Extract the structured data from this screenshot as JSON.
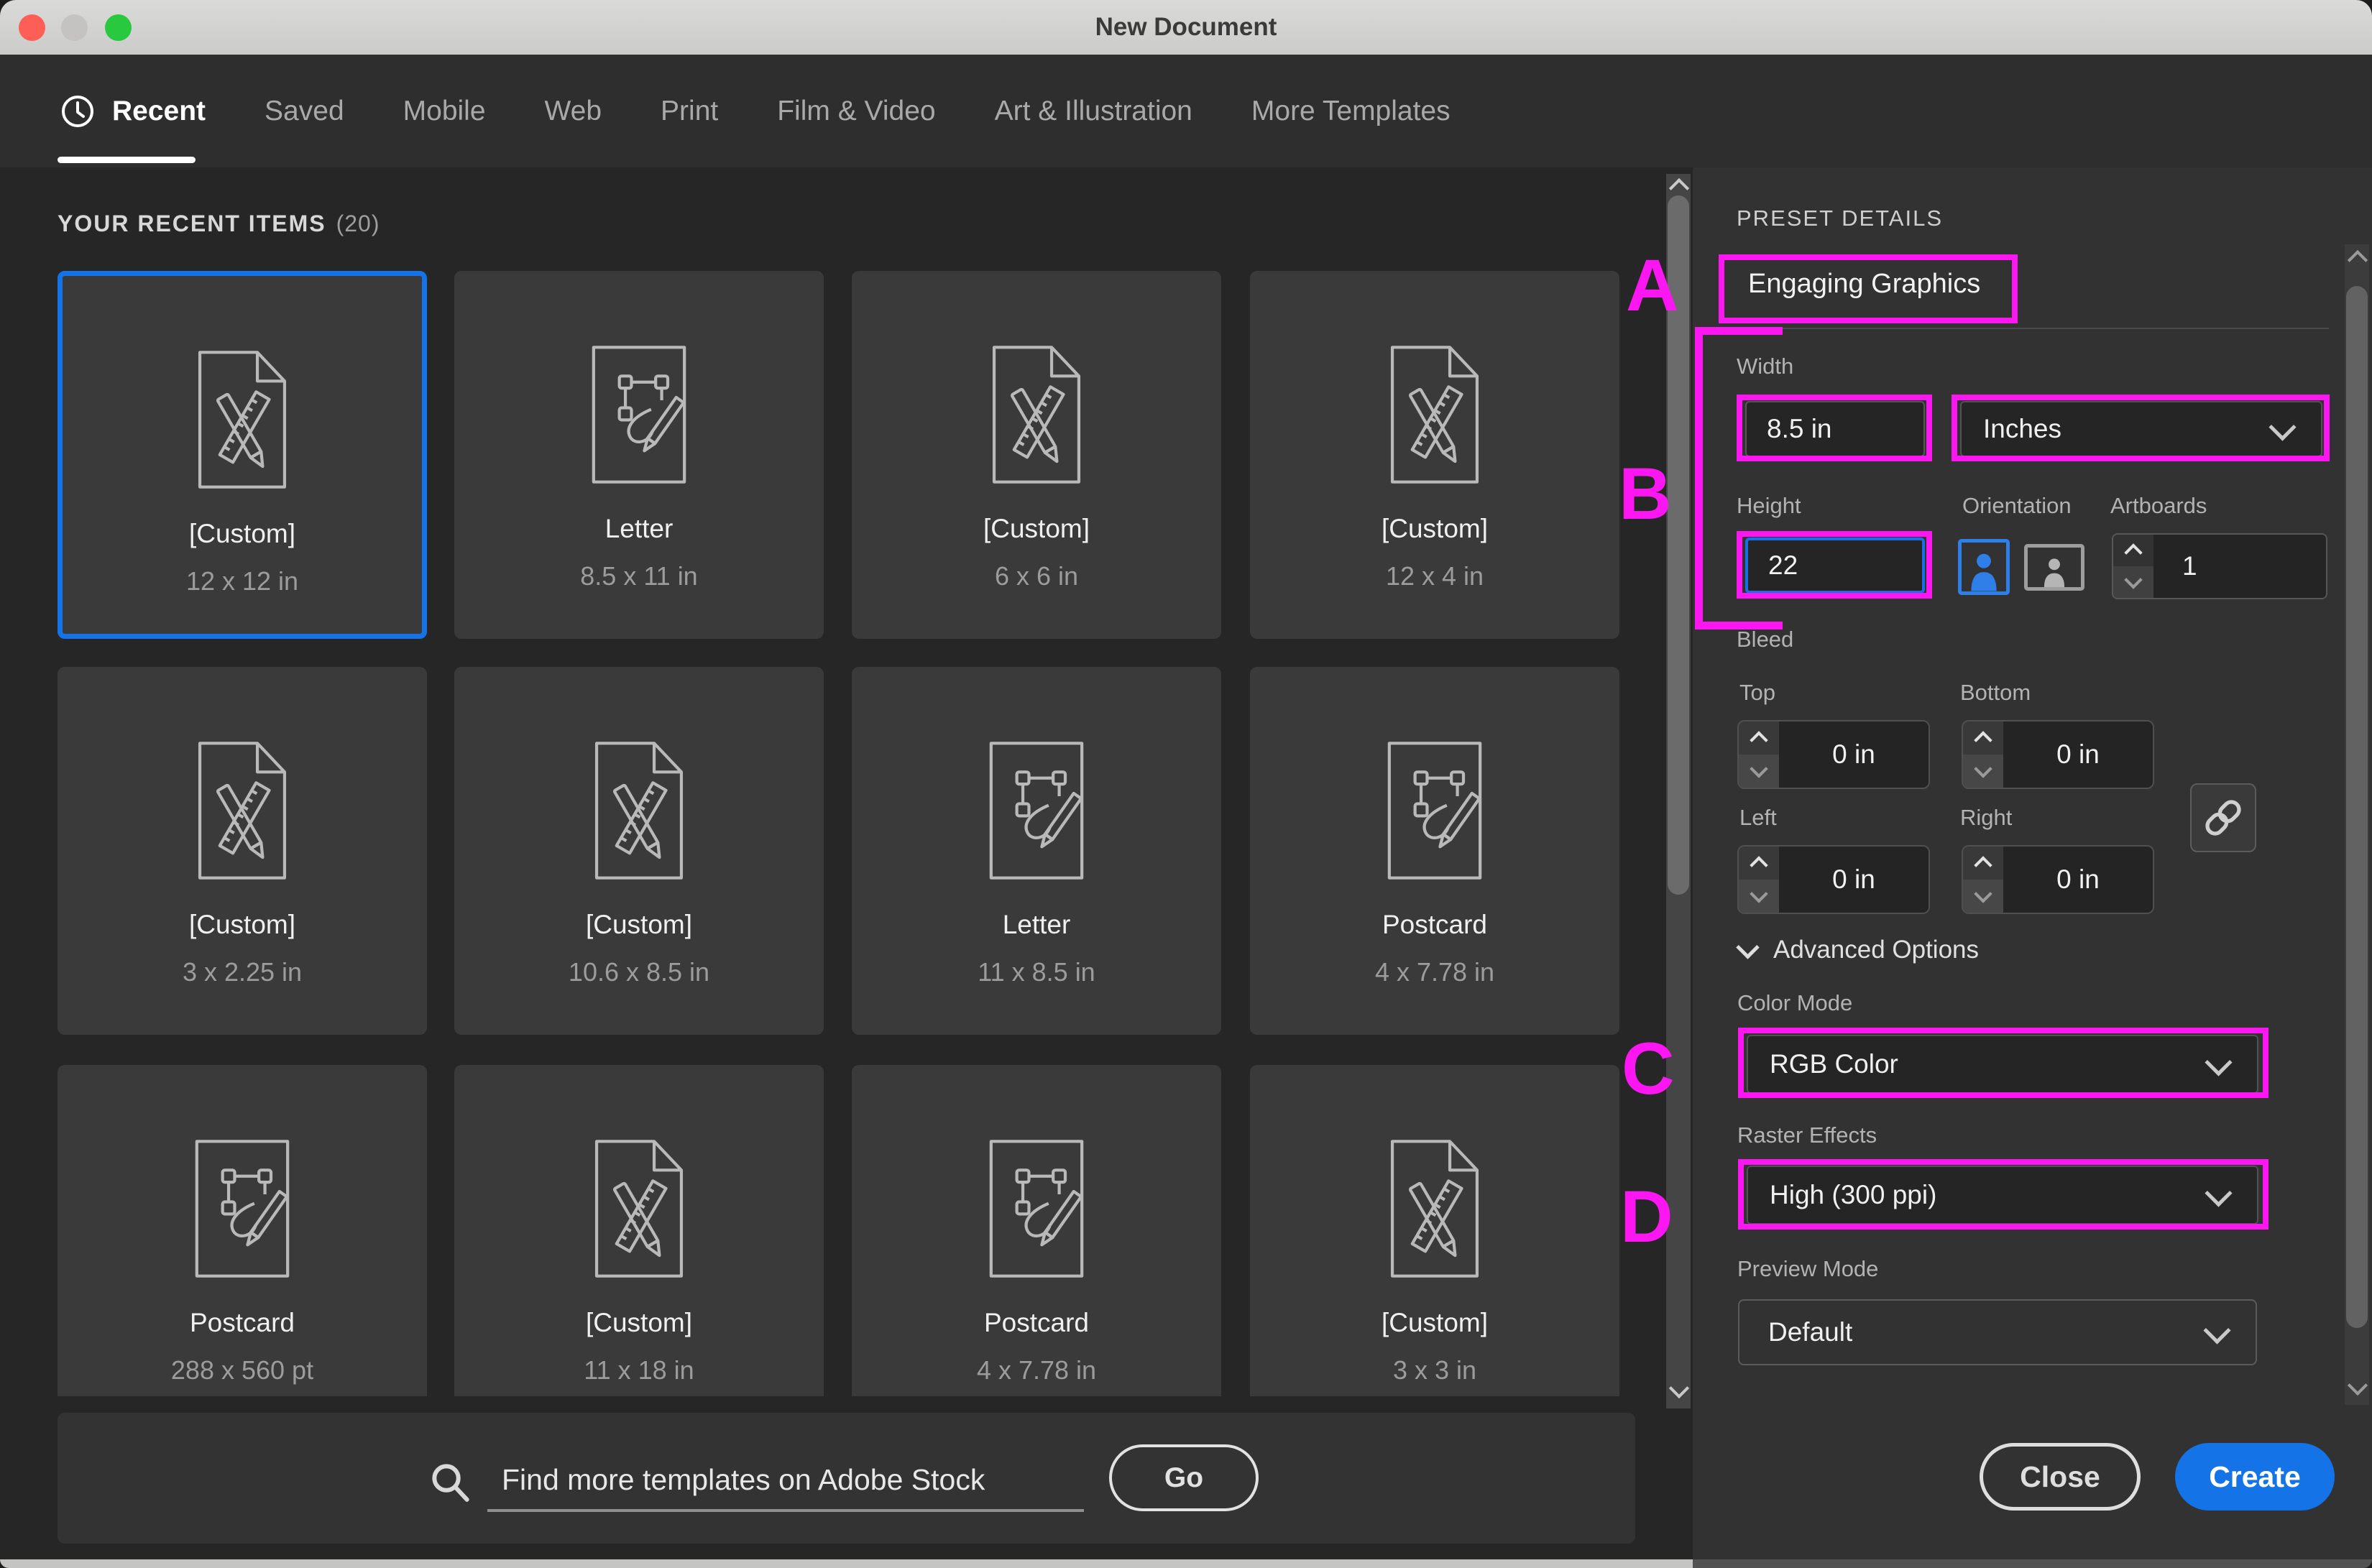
{
  "window": {
    "title": "New Document",
    "traffic_lights": [
      "close",
      "minimize",
      "zoom"
    ]
  },
  "tabs": {
    "items": [
      {
        "label": "Recent",
        "active": true,
        "icon": "clock-icon"
      },
      {
        "label": "Saved",
        "active": false
      },
      {
        "label": "Mobile",
        "active": false
      },
      {
        "label": "Web",
        "active": false
      },
      {
        "label": "Print",
        "active": false
      },
      {
        "label": "Film & Video",
        "active": false
      },
      {
        "label": "Art & Illustration",
        "active": false
      },
      {
        "label": "More Templates",
        "active": false
      }
    ]
  },
  "recent": {
    "heading": "YOUR RECENT ITEMS",
    "count": "(20)",
    "items": [
      {
        "name": "[Custom]",
        "size": "12 x 12 in",
        "icon": "custom-doc-icon",
        "selected": true
      },
      {
        "name": "Letter",
        "size": "8.5 x 11 in",
        "icon": "vector-pen-icon",
        "selected": false
      },
      {
        "name": "[Custom]",
        "size": "6 x 6 in",
        "icon": "custom-doc-icon",
        "selected": false
      },
      {
        "name": "[Custom]",
        "size": "12 x 4 in",
        "icon": "custom-doc-icon",
        "selected": false
      },
      {
        "name": "[Custom]",
        "size": "3 x 2.25 in",
        "icon": "custom-doc-icon",
        "selected": false
      },
      {
        "name": "[Custom]",
        "size": "10.6 x 8.5 in",
        "icon": "custom-doc-icon",
        "selected": false
      },
      {
        "name": "Letter",
        "size": "11 x 8.5 in",
        "icon": "vector-pen-icon",
        "selected": false
      },
      {
        "name": "Postcard",
        "size": "4 x 7.78 in",
        "icon": "vector-pen-icon",
        "selected": false
      },
      {
        "name": "Postcard",
        "size": "288 x 560 pt",
        "icon": "vector-pen-icon",
        "selected": false
      },
      {
        "name": "[Custom]",
        "size": "11 x 18 in",
        "icon": "custom-doc-icon",
        "selected": false
      },
      {
        "name": "Postcard",
        "size": "4 x 7.78 in",
        "icon": "vector-pen-icon",
        "selected": false
      },
      {
        "name": "[Custom]",
        "size": "3 x 3 in",
        "icon": "custom-doc-icon",
        "selected": false
      }
    ]
  },
  "search": {
    "placeholder": "Find more templates on Adobe Stock",
    "go_label": "Go"
  },
  "preset": {
    "heading": "PRESET DETAILS",
    "name_value": "Engaging Graphics",
    "width": {
      "label": "Width",
      "value": "8.5 in"
    },
    "units": {
      "value": "Inches"
    },
    "height": {
      "label": "Height",
      "value": "22"
    },
    "orientation_label": "Orientation",
    "artboards": {
      "label": "Artboards",
      "value": "1"
    },
    "bleed": {
      "label": "Bleed",
      "top_label": "Top",
      "top": "0 in",
      "bottom_label": "Bottom",
      "bottom": "0 in",
      "left_label": "Left",
      "left": "0 in",
      "right_label": "Right",
      "right": "0 in"
    },
    "advanced_label": "Advanced Options",
    "color_mode": {
      "label": "Color Mode",
      "value": "RGB Color"
    },
    "raster": {
      "label": "Raster Effects",
      "value": "High (300 ppi)"
    },
    "preview": {
      "label": "Preview Mode",
      "value": "Default"
    },
    "close_label": "Close",
    "create_label": "Create"
  },
  "annotations": {
    "a": "A",
    "b": "B",
    "c": "C",
    "d": "D",
    "highlight_color": "#FB16F2"
  },
  "colors": {
    "accent_blue": "#1473E6",
    "selected_card_border": "#1473E6",
    "titlebar": "#D2D2D0",
    "tabbar_bg": "#2E2E2E",
    "grid_bg": "#262626",
    "panel_bg": "#323232",
    "card_bg": "#3A3A3A",
    "traffic_red": "#FD5F57",
    "traffic_gray": "#C5C3C1",
    "traffic_green": "#28C83F"
  }
}
